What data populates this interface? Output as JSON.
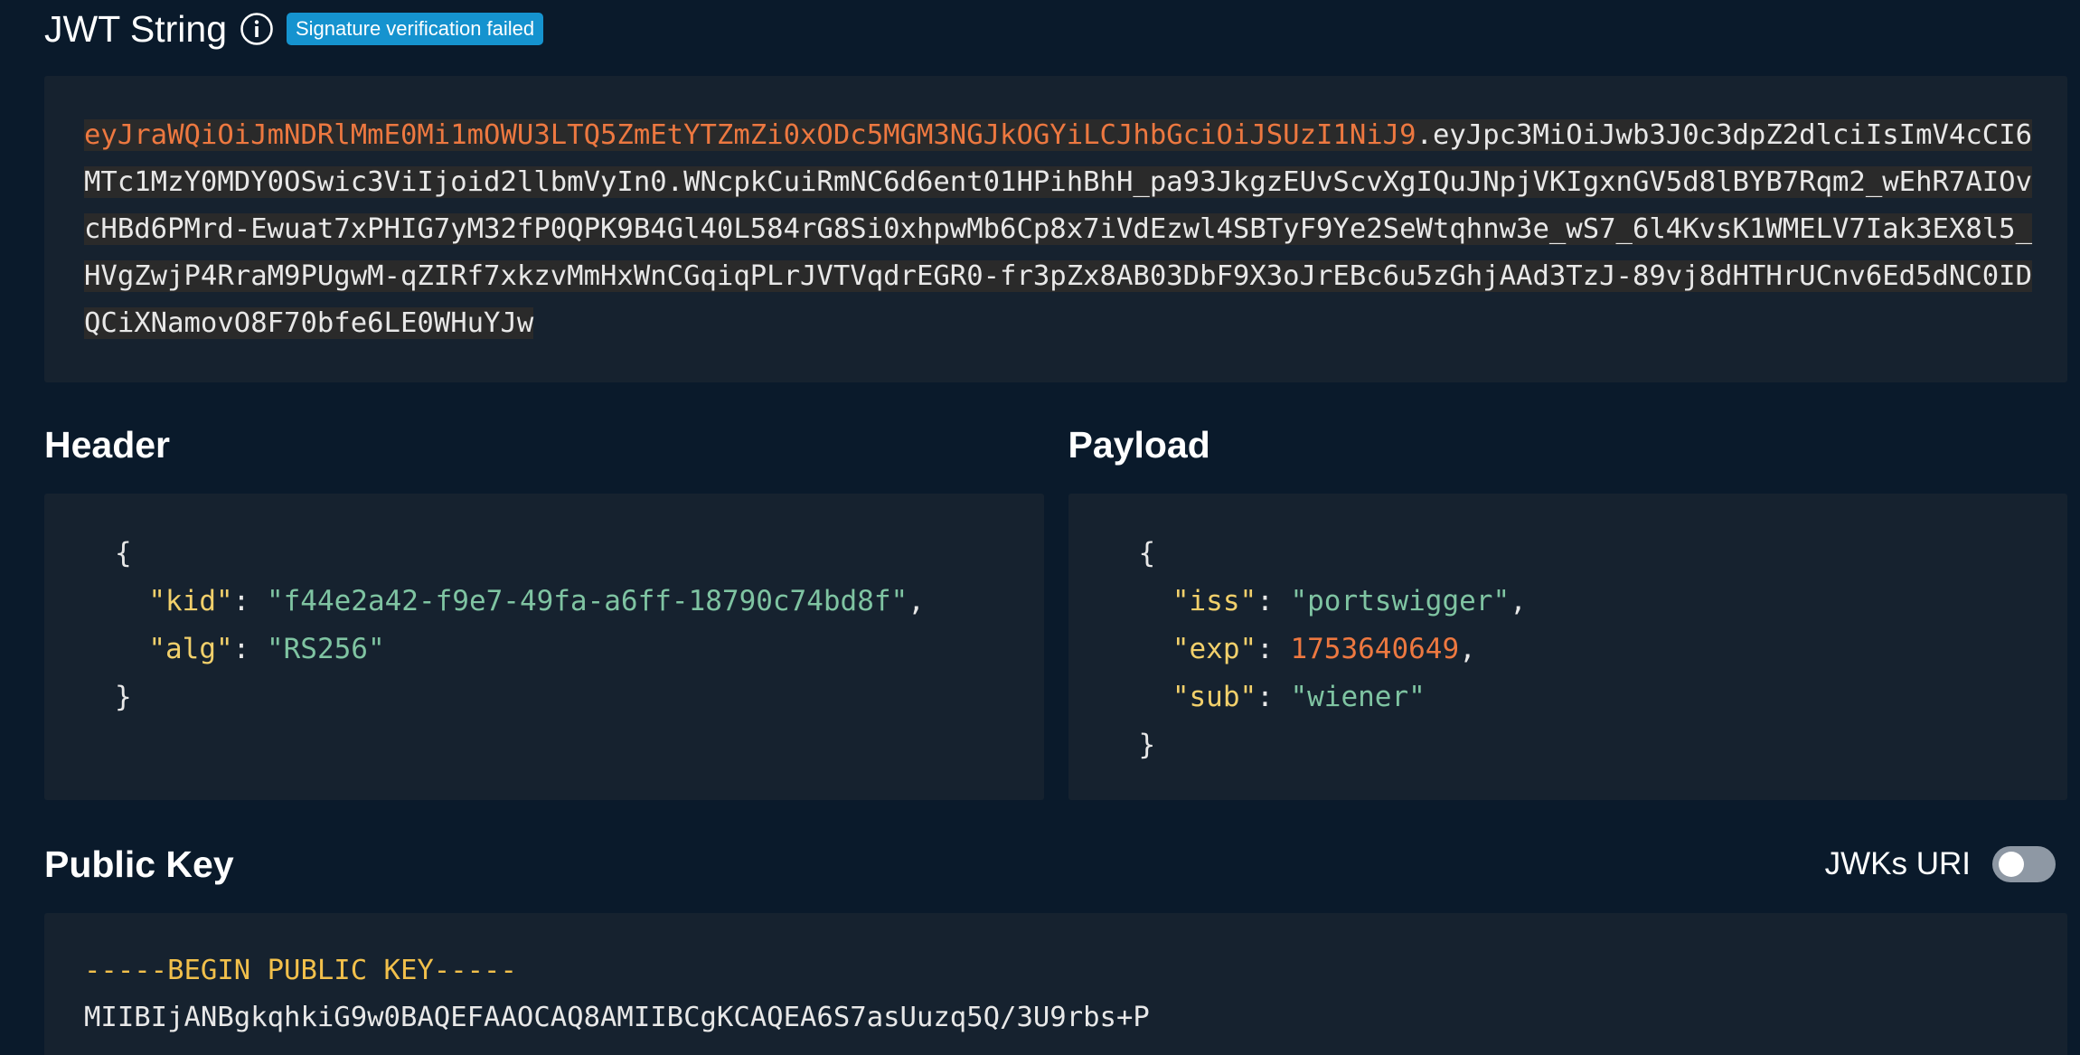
{
  "jwt_section": {
    "title": "JWT String",
    "badge": "Signature verification failed",
    "token_header": "eyJraWQiOiJmNDRlMmE0Mi1mOWU3LTQ5ZmEtYTZmZi0xODc5MGM3NGJkOGYiLCJhbGciOiJSUzI1NiJ9",
    "token_sep": ".",
    "token_rest": "eyJpc3MiOiJwb3J0c3dpZ2dlciIsImV4cCI6MTc1MzY0MDY0OSwic3ViIjoid2llbmVyIn0.WNcpkCuiRmNC6d6ent01HPihBhH_pa93JkgzEUvScvXgIQuJNpjVKIgxnGV5d8lBYB7Rqm2_wEhR7AIOvcHBd6PMrd-Ewuat7xPHIG7yM32fP0QPK9B4Gl40L584rG8Si0xhpwMb6Cp8x7iVdEzwl4SBTyF9Ye2SeWtqhnw3e_wS7_6l4KvsK1WMELV7Iak3EX8l5_HVgZwjP4RraM9PUgwM-qZIRf7xkzvMmHxWnCGqiqPLrJVTVqdrEGR0-fr3pZx8AB03DbF9X3oJrEBc6u5zGhjAAd3TzJ-89vj8dHTHrUCnv6Ed5dNC0IDQCiXNamovO8F70bfe6LE0WHuYJw"
  },
  "header_section": {
    "title": "Header",
    "open_brace": "{",
    "close_brace": "}",
    "entries": [
      {
        "key": "\"kid\"",
        "value": "\"f44e2a42-f9e7-49fa-a6ff-18790c74bd8f\"",
        "trail": ","
      },
      {
        "key": "\"alg\"",
        "value": "\"RS256\"",
        "trail": ""
      }
    ]
  },
  "payload_section": {
    "title": "Payload",
    "open_brace": "{",
    "close_brace": "}",
    "entries": [
      {
        "key": "\"iss\"",
        "value": "\"portswigger\"",
        "type": "string",
        "trail": ","
      },
      {
        "key": "\"exp\"",
        "value": "1753640649",
        "type": "number",
        "trail": ","
      },
      {
        "key": "\"sub\"",
        "value": "\"wiener\"",
        "type": "string",
        "trail": ""
      }
    ]
  },
  "public_key_section": {
    "title": "Public Key",
    "jwks_label": "JWKs URI",
    "jwks_enabled": false,
    "begin_line": "-----BEGIN PUBLIC KEY-----",
    "line_1": "MIIBIjANBgkqhkiG9w0BAQEFAAOCAQ8AMIIBCgKCAQEA6S7asUuzq5Q/3U9rbs+P"
  },
  "icons": {
    "info": "info-icon"
  },
  "colors": {
    "background": "#0a1a2b",
    "panel": "#16222f",
    "badge": "#1593cf",
    "token_header": "#ed7840",
    "json_key": "#f2d06b",
    "json_string": "#7fc4a2",
    "json_number": "#ed7840"
  }
}
